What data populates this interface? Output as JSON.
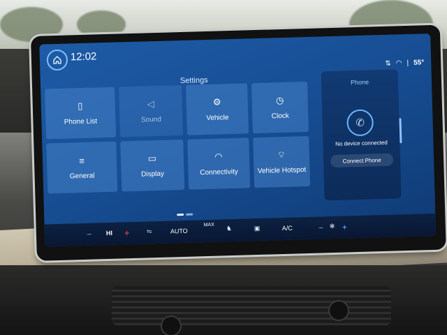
{
  "header": {
    "time": "12:02",
    "temperature": "55°"
  },
  "settings": {
    "title": "Settings",
    "tiles": [
      {
        "label": "Phone List",
        "icon": "phone-list-icon",
        "glyph": "▯"
      },
      {
        "label": "Sound",
        "icon": "speaker-icon",
        "glyph": "◁"
      },
      {
        "label": "Vehicle",
        "icon": "vehicle-icon",
        "glyph": "⚙"
      },
      {
        "label": "Clock",
        "icon": "clock-icon",
        "glyph": "◷"
      },
      {
        "label": "General",
        "icon": "sliders-icon",
        "glyph": "≡"
      },
      {
        "label": "Display",
        "icon": "display-icon",
        "glyph": "▭"
      },
      {
        "label": "Connectivity",
        "icon": "wifi-icon",
        "glyph": "◠"
      },
      {
        "label": "Vehicle Hotspot",
        "icon": "hotspot-icon",
        "glyph": "⌔"
      }
    ]
  },
  "phone": {
    "title": "Phone",
    "status": "No device connected",
    "connect_label": "Connect Phone"
  },
  "climate": {
    "fan": "HI",
    "minus": "−",
    "plus": "+",
    "auto": "AUTO",
    "max": "MAX",
    "ac": "A/C"
  },
  "colors": {
    "accent": "#6db6ff",
    "screen": "#174e94",
    "increase": "#ff4a4a"
  }
}
